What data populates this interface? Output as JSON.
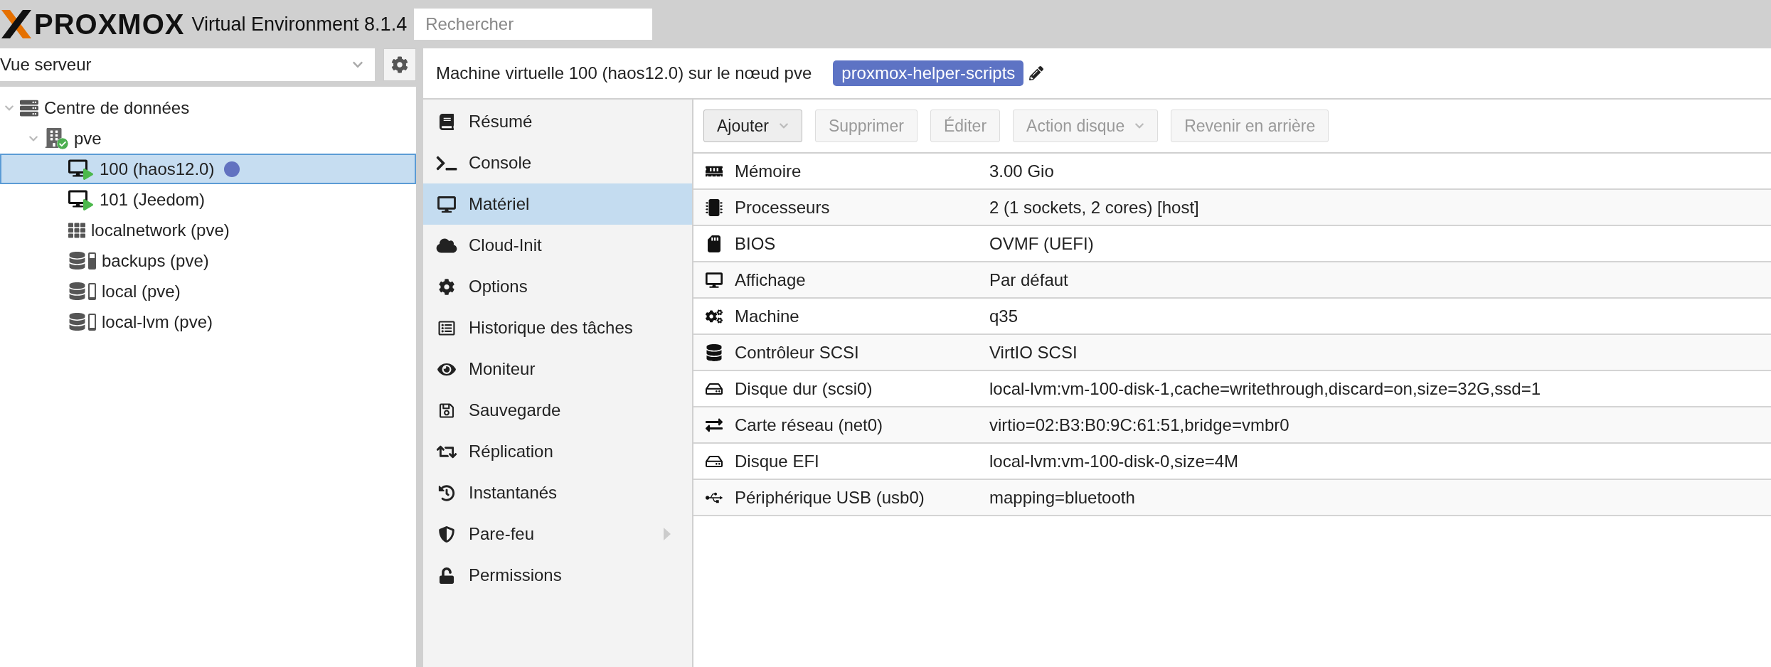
{
  "header": {
    "brand": "PROXMOX",
    "product": "Virtual Environment 8.1.4",
    "search": {
      "placeholder": "Rechercher"
    }
  },
  "sidebar": {
    "view_select": "Vue serveur",
    "tree": [
      {
        "label": "Centre de données",
        "kind": "datacenter",
        "selected": false,
        "expanded": true,
        "children": [
          {
            "label": "pve",
            "kind": "node",
            "selected": false,
            "expanded": true,
            "children": [
              {
                "label": "100 (haos12.0)",
                "kind": "vm",
                "selected": true,
                "color": "#6272c0"
              },
              {
                "label": "101 (Jeedom)",
                "kind": "vm",
                "selected": false
              },
              {
                "label": "localnetwork (pve)",
                "kind": "network",
                "selected": false
              },
              {
                "label": "backups (pve)",
                "kind": "storage",
                "selected": false,
                "level": 0.7
              },
              {
                "label": "local (pve)",
                "kind": "storage",
                "selected": false,
                "level": 0.1
              },
              {
                "label": "local-lvm (pve)",
                "kind": "storage",
                "selected": false,
                "level": 0.1
              }
            ]
          }
        ]
      }
    ]
  },
  "content": {
    "title": "Machine virtuelle 100 (haos12.0) sur le nœud pve",
    "tag": "proxmox-helper-scripts",
    "nav": [
      {
        "label": "Résumé",
        "selected": false
      },
      {
        "label": "Console",
        "selected": false
      },
      {
        "label": "Matériel",
        "selected": true
      },
      {
        "label": "Cloud-Init",
        "selected": false
      },
      {
        "label": "Options",
        "selected": false
      },
      {
        "label": "Historique des tâches",
        "selected": false
      },
      {
        "label": "Moniteur",
        "selected": false
      },
      {
        "label": "Sauvegarde",
        "selected": false
      },
      {
        "label": "Réplication",
        "selected": false
      },
      {
        "label": "Instantanés",
        "selected": false
      },
      {
        "label": "Pare-feu",
        "selected": false,
        "submenu": true
      },
      {
        "label": "Permissions",
        "selected": false
      }
    ],
    "toolbar": [
      {
        "label": "Ajouter",
        "disabled": false,
        "dropdown": true
      },
      {
        "label": "Supprimer",
        "disabled": true,
        "dropdown": false
      },
      {
        "label": "Éditer",
        "disabled": true,
        "dropdown": false
      },
      {
        "label": "Action disque",
        "disabled": true,
        "dropdown": true
      },
      {
        "label": "Revenir en arrière",
        "disabled": true,
        "dropdown": false
      }
    ],
    "rows": [
      {
        "kind": "memory",
        "name": "Mémoire",
        "value": "3.00 Gio"
      },
      {
        "kind": "cpu",
        "name": "Processeurs",
        "value": "2 (1 sockets, 2 cores) [host]"
      },
      {
        "kind": "bios",
        "name": "BIOS",
        "value": "OVMF (UEFI)"
      },
      {
        "kind": "display",
        "name": "Affichage",
        "value": "Par défaut"
      },
      {
        "kind": "machine",
        "name": "Machine",
        "value": "q35"
      },
      {
        "kind": "controller",
        "name": "Contrôleur SCSI",
        "value": "VirtIO SCSI"
      },
      {
        "kind": "disk",
        "name": "Disque dur (scsi0)",
        "value": "local-lvm:vm-100-disk-1,cache=writethrough,discard=on,size=32G,ssd=1"
      },
      {
        "kind": "network",
        "name": "Carte réseau (net0)",
        "value": "virtio=02:B3:B0:9C:61:51,bridge=vmbr0"
      },
      {
        "kind": "disk",
        "name": "Disque EFI",
        "value": "local-lvm:vm-100-disk-0,size=4M"
      },
      {
        "kind": "usb",
        "name": "Périphérique USB (usb0)",
        "value": "mapping=bluetooth"
      }
    ]
  }
}
